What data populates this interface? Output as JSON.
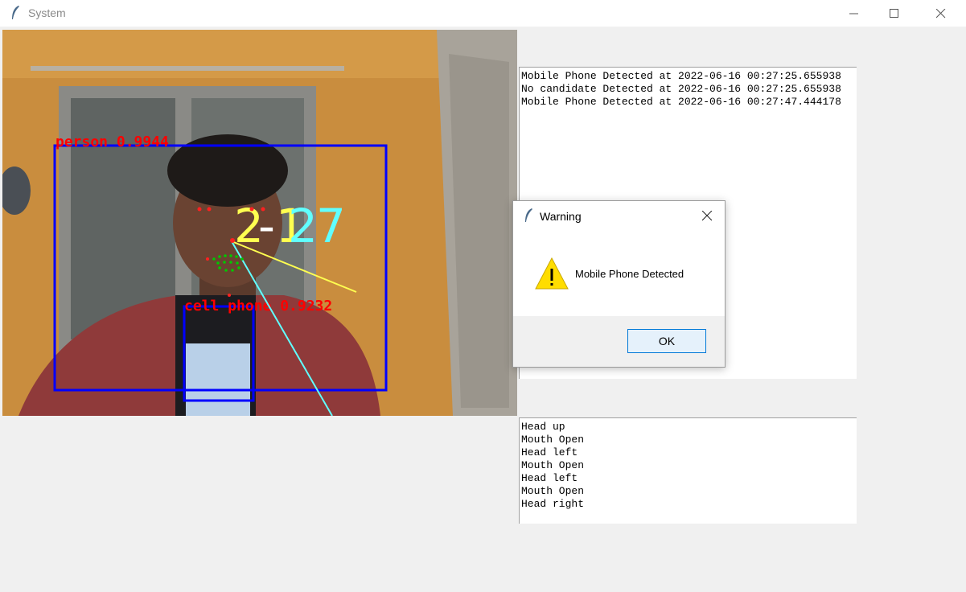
{
  "window": {
    "title": "System",
    "controls": [
      "minimize-icon",
      "maximize-icon",
      "close-icon"
    ]
  },
  "camera": {
    "detections": [
      {
        "label": "person 0.9944",
        "box_color": "#0000ff",
        "label_color": "#ff0000"
      },
      {
        "label": "cell phone 0.9232",
        "box_color": "#0000ff",
        "label_color": "#ff0000"
      }
    ],
    "overlay_number_parts": [
      "2",
      "-",
      "1",
      "2",
      "7"
    ],
    "overlay_colors": {
      "yellow": "#ffff50",
      "cyan": "#60ffff",
      "landmarks": "#00c800"
    }
  },
  "log_top": {
    "lines": [
      "Mobile Phone Detected at 2022-06-16 00:27:25.655938",
      "No candidate Detected at 2022-06-16 00:27:25.655938",
      "Mobile Phone Detected at 2022-06-16 00:27:47.444178"
    ]
  },
  "log_bottom": {
    "lines": [
      "Head up",
      "Mouth Open",
      "Head left",
      "Mouth Open",
      "Head left",
      "Mouth Open",
      "Head right"
    ]
  },
  "dialog": {
    "title": "Warning",
    "message": "Mobile Phone Detected",
    "ok_label": "OK",
    "icon": "warning-icon"
  }
}
